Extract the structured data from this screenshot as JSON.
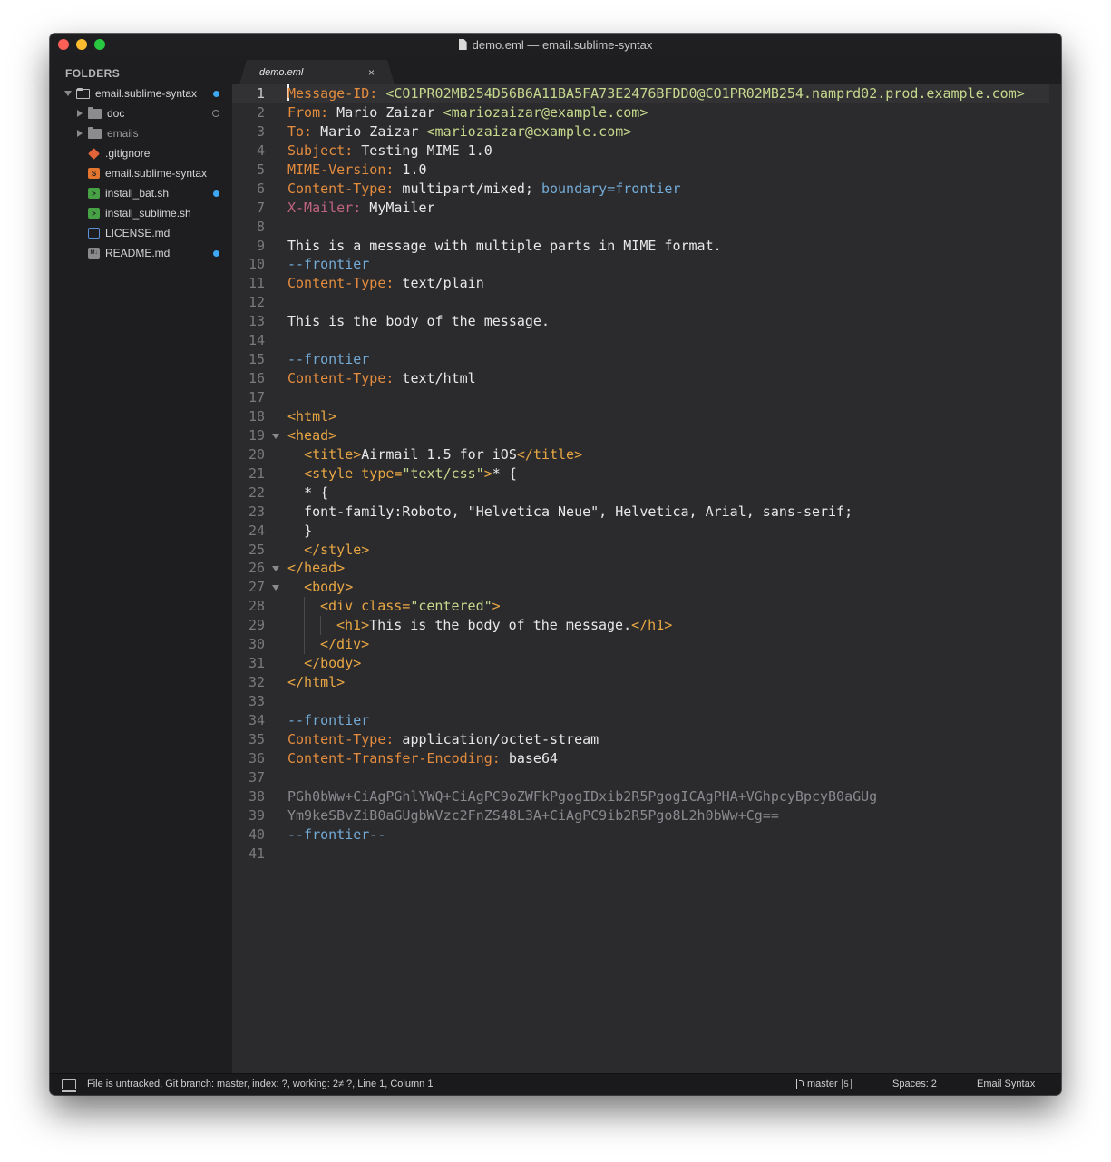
{
  "window": {
    "title": "demo.eml — email.sublime-syntax"
  },
  "sidebar": {
    "header": "FOLDERS",
    "items": [
      {
        "label": "email.sublime-syntax",
        "icon": "folder-open-icon",
        "status": "blue"
      },
      {
        "label": "doc",
        "icon": "folder-icon",
        "status": "ring"
      },
      {
        "label": "emails",
        "icon": "folder-icon",
        "status": "none"
      },
      {
        "label": ".gitignore",
        "icon": "git-icon",
        "status": "none"
      },
      {
        "label": "email.sublime-syntax",
        "icon": "sublime-file-icon",
        "status": "none"
      },
      {
        "label": "install_bat.sh",
        "icon": "shell-script-icon",
        "status": "blue"
      },
      {
        "label": "install_sublime.sh",
        "icon": "shell-script-icon",
        "status": "none"
      },
      {
        "label": "LICENSE.md",
        "icon": "license-icon",
        "status": "none"
      },
      {
        "label": "README.md",
        "icon": "markdown-icon",
        "status": "blue"
      }
    ]
  },
  "tab": {
    "label": "demo.eml",
    "close": "×"
  },
  "editor": {
    "line_numbers": [
      "1",
      "2",
      "3",
      "4",
      "5",
      "6",
      "7",
      "8",
      "9",
      "10",
      "11",
      "12",
      "13",
      "14",
      "15",
      "16",
      "17",
      "18",
      "19",
      "20",
      "21",
      "22",
      "23",
      "24",
      "25",
      "26",
      "27",
      "28",
      "29",
      "30",
      "31",
      "32",
      "33",
      "34",
      "35",
      "36",
      "37",
      "38",
      "39",
      "40",
      "41"
    ],
    "lines": {
      "l1_key": "Message-ID:",
      "l1_val": " <CO1PR02MB254D56B6A11BA5FA73E2476BFDD0@CO1PR02MB254.namprd02.prod.example.com>",
      "l2_key": "From:",
      "l2_name": " Mario Zaizar ",
      "l2_email": "<mariozaizar@example.com>",
      "l3_key": "To:",
      "l3_name": " Mario Zaizar ",
      "l3_email": "<mariozaizar@example.com>",
      "l4_key": "Subject:",
      "l4_val": " Testing MIME 1.0",
      "l5_key": "MIME-Version:",
      "l5_val": " 1.0",
      "l6_key": "Content-Type:",
      "l6_val": " multipart/mixed; ",
      "l6_boundary": "boundary=frontier",
      "l7_key": "X-Mailer:",
      "l7_val": " MyMailer",
      "l9": "This is a message with multiple parts in MIME format.",
      "l10": "--frontier",
      "l11_key": "Content-Type:",
      "l11_val": " text/plain",
      "l13": "This is the body of the message.",
      "l15": "--frontier",
      "l16_key": "Content-Type:",
      "l16_val": " text/html",
      "l18": "<html>",
      "l19": "<head>",
      "l20_open": "<title>",
      "l20_text": "Airmail 1.5 for iOS",
      "l20_close": "</title>",
      "l21_open": "<style ",
      "l21_attr": "type=",
      "l21_str": "\"text/css\"",
      "l21_end": ">",
      "l21_rest": "* {",
      "l22": "* {",
      "l23": "font-family:Roboto, \"Helvetica Neue\", Helvetica, Arial, sans-serif;",
      "l24": "}",
      "l25": "</style>",
      "l26": "</head>",
      "l27": "<body>",
      "l28_open": "<div ",
      "l28_attr": "class=",
      "l28_str": "\"centered\"",
      "l28_end": ">",
      "l29_open": "<h1>",
      "l29_text": "This is the body of the message.",
      "l29_close": "</h1>",
      "l30": "</div>",
      "l31": "</body>",
      "l32": "</html>",
      "l34": "--frontier",
      "l35_key": "Content-Type:",
      "l35_val": " application/octet-stream",
      "l36_key": "Content-Transfer-Encoding:",
      "l36_val": " base64",
      "l38": "PGh0bWw+CiAgPGhlYWQ+CiAgPC9oZWFkPgogIDxib2R5PgogICAgPHA+VGhpcyBpcyB0aGUg",
      "l39": "Ym9keSBvZiB0aGUgbWVzc2FnZS48L3A+CiAgPC9ib2R5Pgo8L2h0bWw+Cg==",
      "l40": "--frontier--"
    }
  },
  "statusbar": {
    "message": "File is untracked, Git branch: master, index: ?, working: 2≠ ?, Line 1, Column 1",
    "branch": "master",
    "branch_badge": "5",
    "spaces": "Spaces: 2",
    "syntax": "Email Syntax"
  }
}
